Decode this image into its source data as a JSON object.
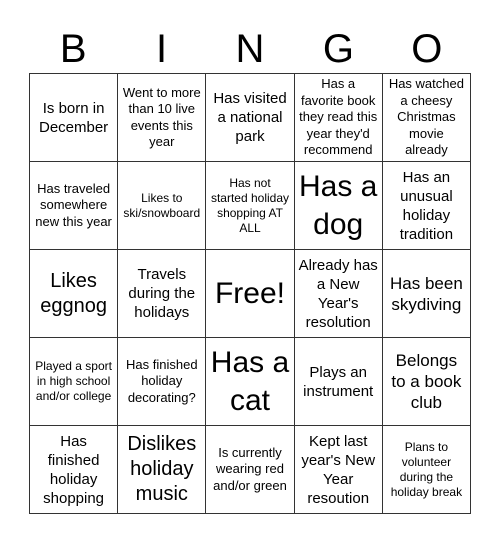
{
  "header": {
    "letters": [
      "B",
      "I",
      "N",
      "G",
      "O"
    ]
  },
  "board": {
    "rows": [
      [
        {
          "text": "Is born in December",
          "size": "s-md"
        },
        {
          "text": "Went to more than 10 live events this year",
          "size": "s-sm"
        },
        {
          "text": "Has visited a national park",
          "size": "s-md"
        },
        {
          "text": "Has a favorite book they read this year they'd recommend",
          "size": "s-sm"
        },
        {
          "text": "Has watched a cheesy Christmas movie already",
          "size": "s-sm"
        }
      ],
      [
        {
          "text": "Has traveled somewhere new this year",
          "size": "s-sm"
        },
        {
          "text": "Likes to ski/snowboard",
          "size": "s-xs"
        },
        {
          "text": "Has not started holiday shopping AT ALL",
          "size": "s-xs"
        },
        {
          "text": "Has a dog",
          "size": "s-xxl"
        },
        {
          "text": "Has an unusual holiday tradition",
          "size": "s-md"
        }
      ],
      [
        {
          "text": "Likes eggnog",
          "size": "s-xl"
        },
        {
          "text": "Travels during the holidays",
          "size": "s-md"
        },
        {
          "text": "Free!",
          "size": "s-xxl"
        },
        {
          "text": "Already has a New Year's resolution",
          "size": "s-md"
        },
        {
          "text": "Has been skydiving",
          "size": "s-lg"
        }
      ],
      [
        {
          "text": "Played a sport in high school and/or college",
          "size": "s-xs"
        },
        {
          "text": "Has finished holiday decorating?",
          "size": "s-sm"
        },
        {
          "text": "Has a cat",
          "size": "s-xxl"
        },
        {
          "text": "Plays an instrument",
          "size": "s-md"
        },
        {
          "text": "Belongs to a book club",
          "size": "s-lg"
        }
      ],
      [
        {
          "text": "Has finished holiday shopping",
          "size": "s-md"
        },
        {
          "text": "Dislikes holiday music",
          "size": "s-xl"
        },
        {
          "text": "Is currently wearing red and/or green",
          "size": "s-sm"
        },
        {
          "text": "Kept last year's New Year resoution",
          "size": "s-md"
        },
        {
          "text": "Plans to volunteer during the holiday break",
          "size": "s-xs"
        }
      ]
    ]
  }
}
